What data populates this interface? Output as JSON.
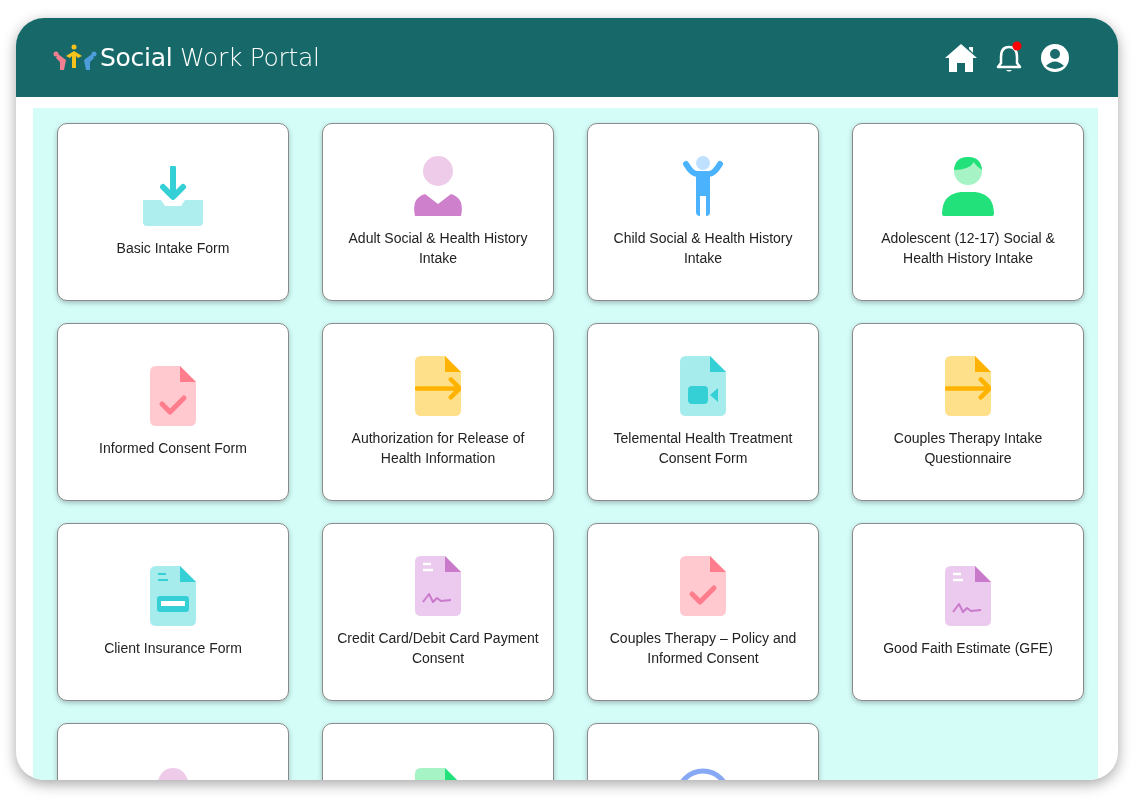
{
  "header": {
    "title": "**Social** Work Portal",
    "has_notification": true
  },
  "cards": [
    {
      "kind": "download",
      "label": "Basic Intake Form"
    },
    {
      "kind": "adult",
      "label": "Adult Social & Health History Intake"
    },
    {
      "kind": "child",
      "label": "Child Social & Health History Intake"
    },
    {
      "kind": "teen",
      "label": "Adolescent (12-17) Social & Health History Intake"
    },
    {
      "kind": "doc-check",
      "label": "Informed Consent Form"
    },
    {
      "kind": "doc-arrow",
      "label": "Authorization for Release of Health Information"
    },
    {
      "kind": "doc-video",
      "label": "Telemental Health Treatment Consent Form"
    },
    {
      "kind": "doc-arrow",
      "label": "Couples Therapy Intake Questionnaire"
    },
    {
      "kind": "doc-card",
      "label": "Client Insurance Form"
    },
    {
      "kind": "doc-sign",
      "label": "Credit Card/Debit Card Payment Consent"
    },
    {
      "kind": "doc-check",
      "label": "Couples Therapy – Policy and Informed Consent"
    },
    {
      "kind": "doc-sign",
      "label": "Good Faith Estimate (GFE)"
    },
    {
      "kind": "person"
    },
    {
      "kind": "doc-green"
    },
    {
      "kind": "ring"
    }
  ]
}
